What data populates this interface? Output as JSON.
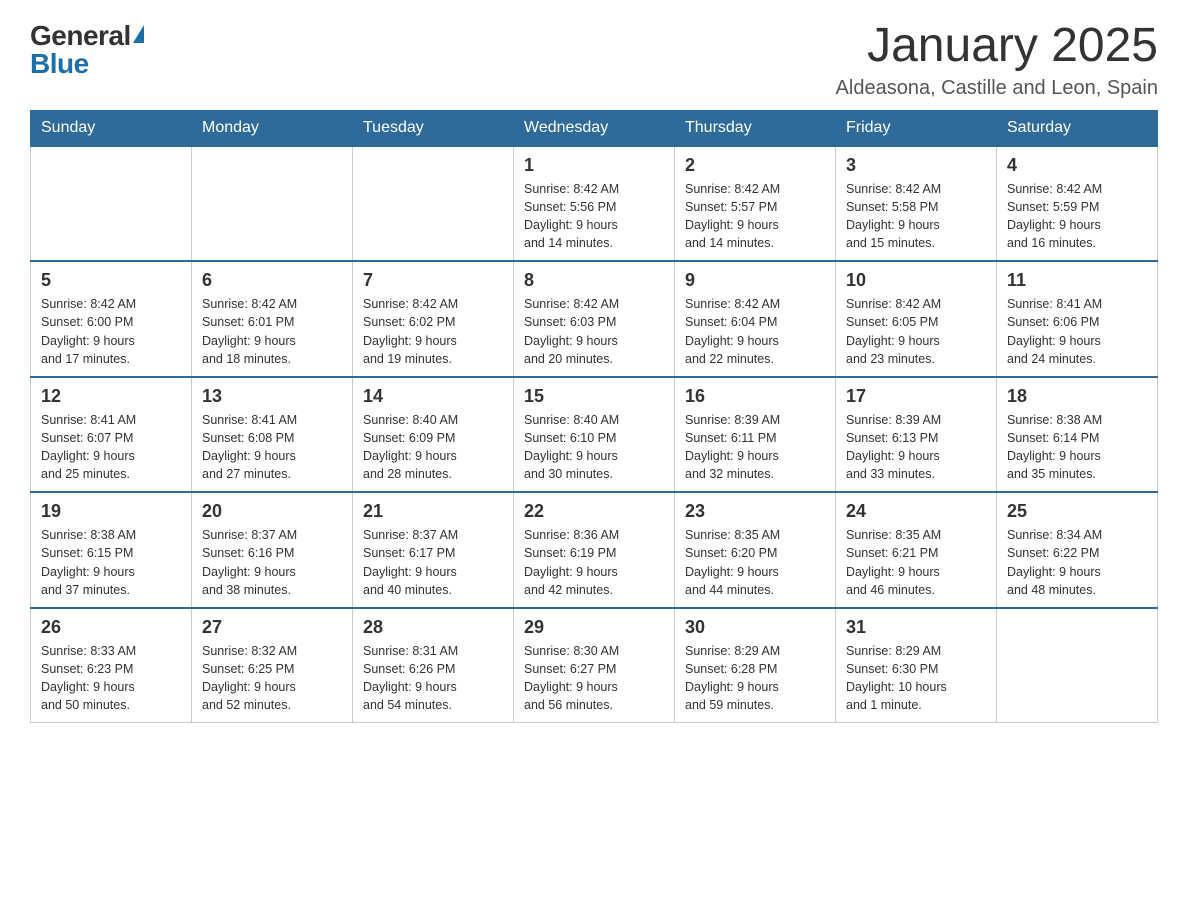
{
  "header": {
    "logo_line1": "General",
    "logo_line2": "Blue",
    "month_title": "January 2025",
    "location": "Aldeasona, Castille and Leon, Spain"
  },
  "days_of_week": [
    "Sunday",
    "Monday",
    "Tuesday",
    "Wednesday",
    "Thursday",
    "Friday",
    "Saturday"
  ],
  "weeks": [
    [
      {
        "day": "",
        "info": ""
      },
      {
        "day": "",
        "info": ""
      },
      {
        "day": "",
        "info": ""
      },
      {
        "day": "1",
        "info": "Sunrise: 8:42 AM\nSunset: 5:56 PM\nDaylight: 9 hours\nand 14 minutes."
      },
      {
        "day": "2",
        "info": "Sunrise: 8:42 AM\nSunset: 5:57 PM\nDaylight: 9 hours\nand 14 minutes."
      },
      {
        "day": "3",
        "info": "Sunrise: 8:42 AM\nSunset: 5:58 PM\nDaylight: 9 hours\nand 15 minutes."
      },
      {
        "day": "4",
        "info": "Sunrise: 8:42 AM\nSunset: 5:59 PM\nDaylight: 9 hours\nand 16 minutes."
      }
    ],
    [
      {
        "day": "5",
        "info": "Sunrise: 8:42 AM\nSunset: 6:00 PM\nDaylight: 9 hours\nand 17 minutes."
      },
      {
        "day": "6",
        "info": "Sunrise: 8:42 AM\nSunset: 6:01 PM\nDaylight: 9 hours\nand 18 minutes."
      },
      {
        "day": "7",
        "info": "Sunrise: 8:42 AM\nSunset: 6:02 PM\nDaylight: 9 hours\nand 19 minutes."
      },
      {
        "day": "8",
        "info": "Sunrise: 8:42 AM\nSunset: 6:03 PM\nDaylight: 9 hours\nand 20 minutes."
      },
      {
        "day": "9",
        "info": "Sunrise: 8:42 AM\nSunset: 6:04 PM\nDaylight: 9 hours\nand 22 minutes."
      },
      {
        "day": "10",
        "info": "Sunrise: 8:42 AM\nSunset: 6:05 PM\nDaylight: 9 hours\nand 23 minutes."
      },
      {
        "day": "11",
        "info": "Sunrise: 8:41 AM\nSunset: 6:06 PM\nDaylight: 9 hours\nand 24 minutes."
      }
    ],
    [
      {
        "day": "12",
        "info": "Sunrise: 8:41 AM\nSunset: 6:07 PM\nDaylight: 9 hours\nand 25 minutes."
      },
      {
        "day": "13",
        "info": "Sunrise: 8:41 AM\nSunset: 6:08 PM\nDaylight: 9 hours\nand 27 minutes."
      },
      {
        "day": "14",
        "info": "Sunrise: 8:40 AM\nSunset: 6:09 PM\nDaylight: 9 hours\nand 28 minutes."
      },
      {
        "day": "15",
        "info": "Sunrise: 8:40 AM\nSunset: 6:10 PM\nDaylight: 9 hours\nand 30 minutes."
      },
      {
        "day": "16",
        "info": "Sunrise: 8:39 AM\nSunset: 6:11 PM\nDaylight: 9 hours\nand 32 minutes."
      },
      {
        "day": "17",
        "info": "Sunrise: 8:39 AM\nSunset: 6:13 PM\nDaylight: 9 hours\nand 33 minutes."
      },
      {
        "day": "18",
        "info": "Sunrise: 8:38 AM\nSunset: 6:14 PM\nDaylight: 9 hours\nand 35 minutes."
      }
    ],
    [
      {
        "day": "19",
        "info": "Sunrise: 8:38 AM\nSunset: 6:15 PM\nDaylight: 9 hours\nand 37 minutes."
      },
      {
        "day": "20",
        "info": "Sunrise: 8:37 AM\nSunset: 6:16 PM\nDaylight: 9 hours\nand 38 minutes."
      },
      {
        "day": "21",
        "info": "Sunrise: 8:37 AM\nSunset: 6:17 PM\nDaylight: 9 hours\nand 40 minutes."
      },
      {
        "day": "22",
        "info": "Sunrise: 8:36 AM\nSunset: 6:19 PM\nDaylight: 9 hours\nand 42 minutes."
      },
      {
        "day": "23",
        "info": "Sunrise: 8:35 AM\nSunset: 6:20 PM\nDaylight: 9 hours\nand 44 minutes."
      },
      {
        "day": "24",
        "info": "Sunrise: 8:35 AM\nSunset: 6:21 PM\nDaylight: 9 hours\nand 46 minutes."
      },
      {
        "day": "25",
        "info": "Sunrise: 8:34 AM\nSunset: 6:22 PM\nDaylight: 9 hours\nand 48 minutes."
      }
    ],
    [
      {
        "day": "26",
        "info": "Sunrise: 8:33 AM\nSunset: 6:23 PM\nDaylight: 9 hours\nand 50 minutes."
      },
      {
        "day": "27",
        "info": "Sunrise: 8:32 AM\nSunset: 6:25 PM\nDaylight: 9 hours\nand 52 minutes."
      },
      {
        "day": "28",
        "info": "Sunrise: 8:31 AM\nSunset: 6:26 PM\nDaylight: 9 hours\nand 54 minutes."
      },
      {
        "day": "29",
        "info": "Sunrise: 8:30 AM\nSunset: 6:27 PM\nDaylight: 9 hours\nand 56 minutes."
      },
      {
        "day": "30",
        "info": "Sunrise: 8:29 AM\nSunset: 6:28 PM\nDaylight: 9 hours\nand 59 minutes."
      },
      {
        "day": "31",
        "info": "Sunrise: 8:29 AM\nSunset: 6:30 PM\nDaylight: 10 hours\nand 1 minute."
      },
      {
        "day": "",
        "info": ""
      }
    ]
  ]
}
